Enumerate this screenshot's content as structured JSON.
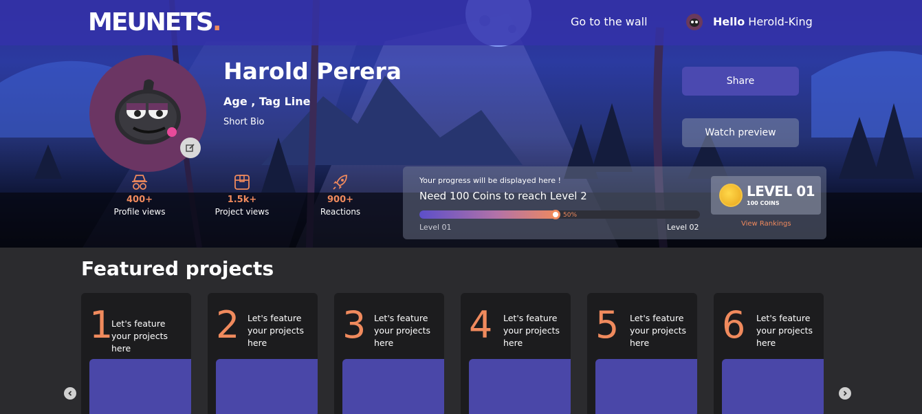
{
  "nav": {
    "logo_text": "MEUNETS",
    "logo_dot": ".",
    "wall_link": "Go to the wall",
    "greet_hello": "Hello",
    "greet_user": "Herold-King"
  },
  "profile": {
    "name": "Harold Perera",
    "tagline": "Age , Tag Line",
    "bio": "Short Bio"
  },
  "stats": [
    {
      "value": "400+",
      "label": "Profile views",
      "icon": "spy-icon"
    },
    {
      "value": "1.5k+",
      "label": "Project views",
      "icon": "box-icon"
    },
    {
      "value": "900+",
      "label": "Reactions",
      "icon": "rocket-icon"
    }
  ],
  "actions": {
    "share": "Share",
    "watch": "Watch preview"
  },
  "progress": {
    "note": "Your progress will be displayed here !",
    "need": "Need 100 Coins to reach Level 2",
    "percent_label": "50%",
    "percent": 0.5,
    "from_level": "Level 01",
    "to_level": "Level 02",
    "level_title": "LEVEL 01",
    "level_coins": "100 COINS",
    "rankings_link": "View Rankings"
  },
  "featured": {
    "title": "Featured projects",
    "cards": [
      {
        "num": "1",
        "text": "Let's feature your projects here"
      },
      {
        "num": "2",
        "text": "Let's feature your projects here"
      },
      {
        "num": "3",
        "text": "Let's feature your projects here"
      },
      {
        "num": "4",
        "text": "Let's feature your projects here"
      },
      {
        "num": "5",
        "text": "Let's feature your projects here"
      },
      {
        "num": "6",
        "text": "Let's feature your projects here"
      }
    ]
  },
  "colors": {
    "accent": "#f08a5d",
    "primary": "#4b49b0",
    "nav_bg": "#3432aa",
    "card_bg": "#1c1c1e",
    "page_bg": "#2b2b2e"
  }
}
